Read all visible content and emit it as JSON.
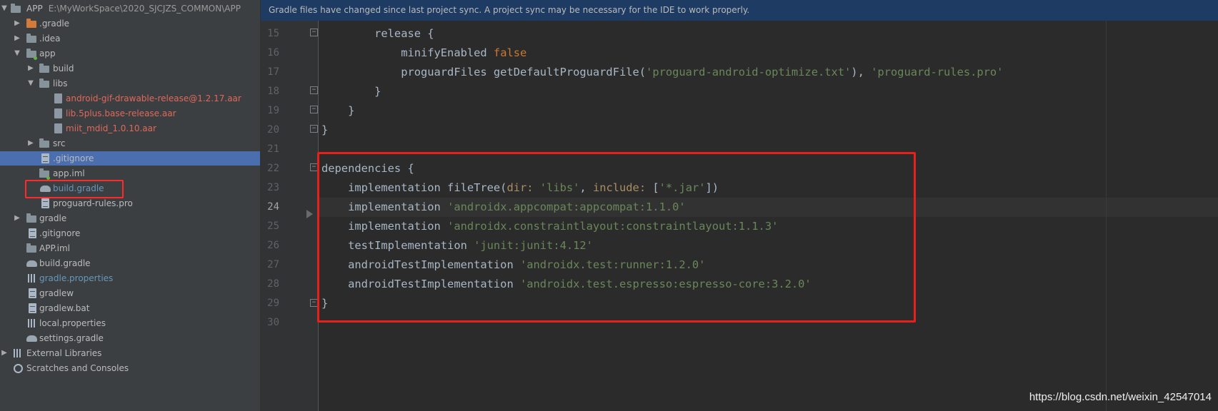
{
  "project": {
    "root_name": "APP",
    "root_path": "E:\\MyWorkSpace\\2020_SJCJZS_COMMON\\APP",
    "items": [
      {
        "label": ".gradle"
      },
      {
        "label": ".idea"
      },
      {
        "label": "app"
      },
      {
        "label": "build"
      },
      {
        "label": "libs"
      },
      {
        "label": "android-gif-drawable-release@1.2.17.aar"
      },
      {
        "label": "lib.5plus.base-release.aar"
      },
      {
        "label": "miit_mdid_1.0.10.aar"
      },
      {
        "label": "src"
      },
      {
        "label": ".gitignore"
      },
      {
        "label": "app.iml"
      },
      {
        "label": "build.gradle"
      },
      {
        "label": "proguard-rules.pro"
      },
      {
        "label": "gradle"
      },
      {
        "label": ".gitignore"
      },
      {
        "label": "APP.iml"
      },
      {
        "label": "build.gradle"
      },
      {
        "label": "gradle.properties"
      },
      {
        "label": "gradlew"
      },
      {
        "label": "gradlew.bat"
      },
      {
        "label": "local.properties"
      },
      {
        "label": "settings.gradle"
      },
      {
        "label": "External Libraries"
      },
      {
        "label": "Scratches and Consoles"
      }
    ]
  },
  "editor": {
    "notice": "Gradle files have changed since last project sync. A project sync may be necessary for the IDE to work properly.",
    "current_line": "24",
    "lines": [
      {
        "num": "15",
        "t": [
          {
            "s": "        release {"
          }
        ]
      },
      {
        "num": "16",
        "t": [
          {
            "s": "            minifyEnabled "
          },
          {
            "s": "false",
            "c": "kw"
          }
        ]
      },
      {
        "num": "17",
        "t": [
          {
            "s": "            proguardFiles getDefaultProguardFile("
          },
          {
            "s": "'proguard-android-optimize.txt'",
            "c": "str"
          },
          {
            "s": "), "
          },
          {
            "s": "'proguard-rules.pro'",
            "c": "str"
          }
        ]
      },
      {
        "num": "18",
        "t": [
          {
            "s": "        }"
          }
        ]
      },
      {
        "num": "19",
        "t": [
          {
            "s": "    }"
          }
        ]
      },
      {
        "num": "20",
        "t": [
          {
            "s": "}"
          }
        ]
      },
      {
        "num": "21",
        "t": []
      },
      {
        "num": "22",
        "t": [
          {
            "s": "dependencies {"
          }
        ]
      },
      {
        "num": "23",
        "t": [
          {
            "s": "    implementation fileTree("
          },
          {
            "s": "dir: ",
            "c": "param"
          },
          {
            "s": "'libs'",
            "c": "str"
          },
          {
            "s": ", "
          },
          {
            "s": "include: ",
            "c": "param"
          },
          {
            "s": "["
          },
          {
            "s": "'*.jar'",
            "c": "str"
          },
          {
            "s": "])"
          }
        ]
      },
      {
        "num": "24",
        "t": [
          {
            "s": "    implementation "
          },
          {
            "s": "'androidx.appcompat:appcompat:1.1.0'",
            "c": "str"
          }
        ]
      },
      {
        "num": "25",
        "t": [
          {
            "s": "    implementation "
          },
          {
            "s": "'androidx.constraintlayout:constraintlayout:1.1.3'",
            "c": "str"
          }
        ]
      },
      {
        "num": "26",
        "t": [
          {
            "s": "    testImplementation "
          },
          {
            "s": "'junit:junit:4.12'",
            "c": "str"
          }
        ]
      },
      {
        "num": "27",
        "t": [
          {
            "s": "    androidTestImplementation "
          },
          {
            "s": "'androidx.test:runner:1.2.0'",
            "c": "str"
          }
        ]
      },
      {
        "num": "28",
        "t": [
          {
            "s": "    androidTestImplementation "
          },
          {
            "s": "'androidx.test.espresso:espresso-core:3.2.0'",
            "c": "str"
          }
        ]
      },
      {
        "num": "29",
        "t": [
          {
            "s": "}"
          }
        ]
      },
      {
        "num": "30",
        "t": []
      }
    ]
  },
  "watermark": "https://blog.csdn.net/weixin_42547014"
}
